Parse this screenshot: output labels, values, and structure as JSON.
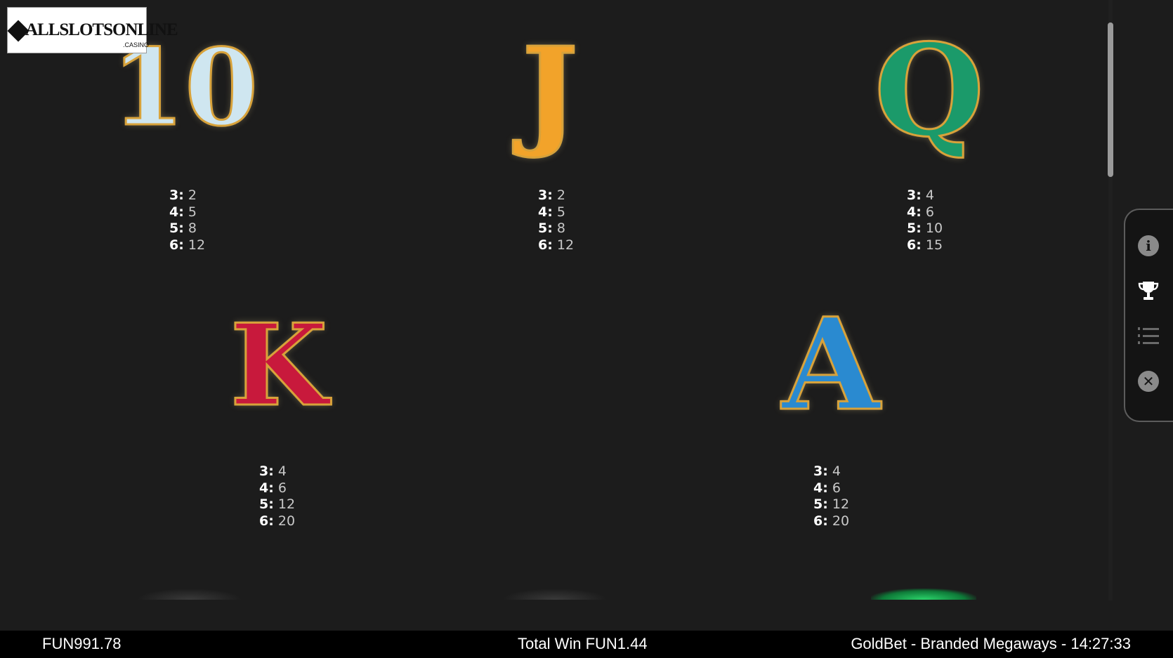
{
  "logo": {
    "text": "ALLSLOTSONLINE",
    "sub": ".CASINO"
  },
  "symbols": [
    {
      "glyph": "10",
      "pays": [
        {
          "count": "3:",
          "value": "2"
        },
        {
          "count": "4:",
          "value": "5"
        },
        {
          "count": "5:",
          "value": "8"
        },
        {
          "count": "6:",
          "value": "12"
        }
      ]
    },
    {
      "glyph": "J",
      "pays": [
        {
          "count": "3:",
          "value": "2"
        },
        {
          "count": "4:",
          "value": "5"
        },
        {
          "count": "5:",
          "value": "8"
        },
        {
          "count": "6:",
          "value": "12"
        }
      ]
    },
    {
      "glyph": "Q",
      "pays": [
        {
          "count": "3:",
          "value": "4"
        },
        {
          "count": "4:",
          "value": "6"
        },
        {
          "count": "5:",
          "value": "10"
        },
        {
          "count": "6:",
          "value": "15"
        }
      ]
    },
    {
      "glyph": "K",
      "pays": [
        {
          "count": "3:",
          "value": "4"
        },
        {
          "count": "4:",
          "value": "6"
        },
        {
          "count": "5:",
          "value": "12"
        },
        {
          "count": "6:",
          "value": "20"
        }
      ]
    },
    {
      "glyph": "A",
      "pays": [
        {
          "count": "3:",
          "value": "4"
        },
        {
          "count": "4:",
          "value": "6"
        },
        {
          "count": "5:",
          "value": "12"
        },
        {
          "count": "6:",
          "value": "20"
        }
      ]
    }
  ],
  "menu": {
    "items": [
      "info-icon",
      "trophy-icon",
      "paylines-icon",
      "close-icon"
    ],
    "info_glyph": "i",
    "close_glyph": "✕"
  },
  "status_bar": {
    "balance": "FUN991.78",
    "total_win": "Total Win FUN1.44",
    "game_info": "GoldBet - Branded Megaways - 14:27:33"
  },
  "colors": {
    "background": "#1c1c1c",
    "ten": "#cfe6f0",
    "j": "#f2a32a",
    "q": "#1b9a6a",
    "k": "#c8193c",
    "a": "#2a8ad0",
    "gold_outline": "#d8a23a"
  }
}
